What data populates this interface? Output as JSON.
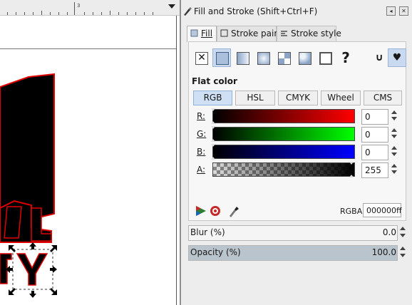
{
  "canvas": {
    "ruler_label": "3",
    "artwork_text": "TY"
  },
  "dialog": {
    "title": "Fill and Stroke (Shift+Ctrl+F)",
    "tabs": [
      {
        "label": "Fill",
        "active": true
      },
      {
        "label": "Stroke paint",
        "active": false
      },
      {
        "label": "Stroke style",
        "active": false
      }
    ],
    "paint_modes": [
      {
        "name": "no-paint",
        "symbol": "✕"
      },
      {
        "name": "flat-color",
        "selected": true
      },
      {
        "name": "linear-gradient"
      },
      {
        "name": "radial-gradient"
      },
      {
        "name": "pattern"
      },
      {
        "name": "swatch"
      },
      {
        "name": "unset",
        "symbol": "?"
      }
    ],
    "fill_rule_symbols": [
      "∪",
      "♥"
    ],
    "section_label": "Flat color",
    "color_modes": [
      "RGB",
      "HSL",
      "CMYK",
      "Wheel",
      "CMS"
    ],
    "active_color_mode": "RGB",
    "channels": [
      {
        "label": "R:",
        "value": "0",
        "color": "#ff0000"
      },
      {
        "label": "G:",
        "value": "0",
        "color": "#00ff00"
      },
      {
        "label": "B:",
        "value": "0",
        "color": "#0000ff"
      },
      {
        "label": "A:",
        "value": "255",
        "color": "#000000"
      }
    ],
    "rgba_label": "RGBA:",
    "rgba_value": "000000ff",
    "blur": {
      "label": "Blur (%)",
      "value": "0.0"
    },
    "opacity": {
      "label": "Opacity (%)",
      "value": "100.0",
      "fraction": 1.0
    }
  }
}
